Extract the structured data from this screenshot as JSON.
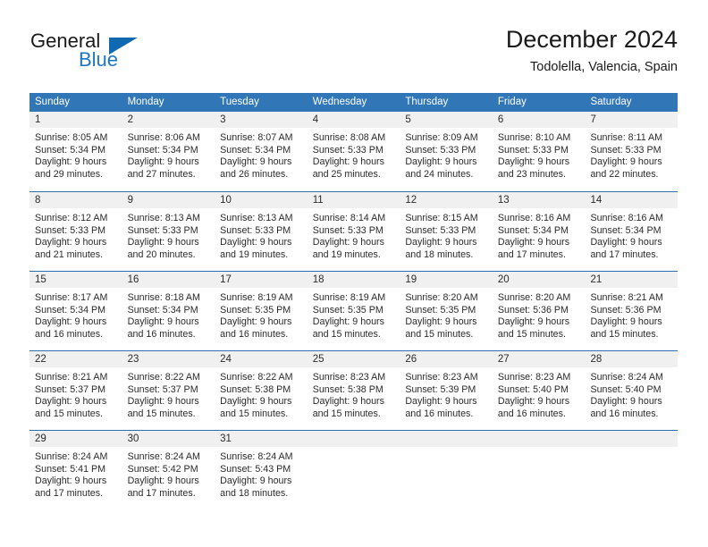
{
  "brand": {
    "name_part1": "General",
    "name_part2": "Blue",
    "accent_color": "#1f77c4"
  },
  "header": {
    "title": "December 2024",
    "location": "Todolella, Valencia, Spain"
  },
  "calendar": {
    "header_bg": "#3176b6",
    "weekdays": [
      "Sunday",
      "Monday",
      "Tuesday",
      "Wednesday",
      "Thursday",
      "Friday",
      "Saturday"
    ],
    "weeks": [
      [
        {
          "day": "1",
          "lines": [
            "Sunrise: 8:05 AM",
            "Sunset: 5:34 PM",
            "Daylight: 9 hours",
            "and 29 minutes."
          ]
        },
        {
          "day": "2",
          "lines": [
            "Sunrise: 8:06 AM",
            "Sunset: 5:34 PM",
            "Daylight: 9 hours",
            "and 27 minutes."
          ]
        },
        {
          "day": "3",
          "lines": [
            "Sunrise: 8:07 AM",
            "Sunset: 5:34 PM",
            "Daylight: 9 hours",
            "and 26 minutes."
          ]
        },
        {
          "day": "4",
          "lines": [
            "Sunrise: 8:08 AM",
            "Sunset: 5:33 PM",
            "Daylight: 9 hours",
            "and 25 minutes."
          ]
        },
        {
          "day": "5",
          "lines": [
            "Sunrise: 8:09 AM",
            "Sunset: 5:33 PM",
            "Daylight: 9 hours",
            "and 24 minutes."
          ]
        },
        {
          "day": "6",
          "lines": [
            "Sunrise: 8:10 AM",
            "Sunset: 5:33 PM",
            "Daylight: 9 hours",
            "and 23 minutes."
          ]
        },
        {
          "day": "7",
          "lines": [
            "Sunrise: 8:11 AM",
            "Sunset: 5:33 PM",
            "Daylight: 9 hours",
            "and 22 minutes."
          ]
        }
      ],
      [
        {
          "day": "8",
          "lines": [
            "Sunrise: 8:12 AM",
            "Sunset: 5:33 PM",
            "Daylight: 9 hours",
            "and 21 minutes."
          ]
        },
        {
          "day": "9",
          "lines": [
            "Sunrise: 8:13 AM",
            "Sunset: 5:33 PM",
            "Daylight: 9 hours",
            "and 20 minutes."
          ]
        },
        {
          "day": "10",
          "lines": [
            "Sunrise: 8:13 AM",
            "Sunset: 5:33 PM",
            "Daylight: 9 hours",
            "and 19 minutes."
          ]
        },
        {
          "day": "11",
          "lines": [
            "Sunrise: 8:14 AM",
            "Sunset: 5:33 PM",
            "Daylight: 9 hours",
            "and 19 minutes."
          ]
        },
        {
          "day": "12",
          "lines": [
            "Sunrise: 8:15 AM",
            "Sunset: 5:33 PM",
            "Daylight: 9 hours",
            "and 18 minutes."
          ]
        },
        {
          "day": "13",
          "lines": [
            "Sunrise: 8:16 AM",
            "Sunset: 5:34 PM",
            "Daylight: 9 hours",
            "and 17 minutes."
          ]
        },
        {
          "day": "14",
          "lines": [
            "Sunrise: 8:16 AM",
            "Sunset: 5:34 PM",
            "Daylight: 9 hours",
            "and 17 minutes."
          ]
        }
      ],
      [
        {
          "day": "15",
          "lines": [
            "Sunrise: 8:17 AM",
            "Sunset: 5:34 PM",
            "Daylight: 9 hours",
            "and 16 minutes."
          ]
        },
        {
          "day": "16",
          "lines": [
            "Sunrise: 8:18 AM",
            "Sunset: 5:34 PM",
            "Daylight: 9 hours",
            "and 16 minutes."
          ]
        },
        {
          "day": "17",
          "lines": [
            "Sunrise: 8:19 AM",
            "Sunset: 5:35 PM",
            "Daylight: 9 hours",
            "and 16 minutes."
          ]
        },
        {
          "day": "18",
          "lines": [
            "Sunrise: 8:19 AM",
            "Sunset: 5:35 PM",
            "Daylight: 9 hours",
            "and 15 minutes."
          ]
        },
        {
          "day": "19",
          "lines": [
            "Sunrise: 8:20 AM",
            "Sunset: 5:35 PM",
            "Daylight: 9 hours",
            "and 15 minutes."
          ]
        },
        {
          "day": "20",
          "lines": [
            "Sunrise: 8:20 AM",
            "Sunset: 5:36 PM",
            "Daylight: 9 hours",
            "and 15 minutes."
          ]
        },
        {
          "day": "21",
          "lines": [
            "Sunrise: 8:21 AM",
            "Sunset: 5:36 PM",
            "Daylight: 9 hours",
            "and 15 minutes."
          ]
        }
      ],
      [
        {
          "day": "22",
          "lines": [
            "Sunrise: 8:21 AM",
            "Sunset: 5:37 PM",
            "Daylight: 9 hours",
            "and 15 minutes."
          ]
        },
        {
          "day": "23",
          "lines": [
            "Sunrise: 8:22 AM",
            "Sunset: 5:37 PM",
            "Daylight: 9 hours",
            "and 15 minutes."
          ]
        },
        {
          "day": "24",
          "lines": [
            "Sunrise: 8:22 AM",
            "Sunset: 5:38 PM",
            "Daylight: 9 hours",
            "and 15 minutes."
          ]
        },
        {
          "day": "25",
          "lines": [
            "Sunrise: 8:23 AM",
            "Sunset: 5:38 PM",
            "Daylight: 9 hours",
            "and 15 minutes."
          ]
        },
        {
          "day": "26",
          "lines": [
            "Sunrise: 8:23 AM",
            "Sunset: 5:39 PM",
            "Daylight: 9 hours",
            "and 16 minutes."
          ]
        },
        {
          "day": "27",
          "lines": [
            "Sunrise: 8:23 AM",
            "Sunset: 5:40 PM",
            "Daylight: 9 hours",
            "and 16 minutes."
          ]
        },
        {
          "day": "28",
          "lines": [
            "Sunrise: 8:24 AM",
            "Sunset: 5:40 PM",
            "Daylight: 9 hours",
            "and 16 minutes."
          ]
        }
      ],
      [
        {
          "day": "29",
          "lines": [
            "Sunrise: 8:24 AM",
            "Sunset: 5:41 PM",
            "Daylight: 9 hours",
            "and 17 minutes."
          ]
        },
        {
          "day": "30",
          "lines": [
            "Sunrise: 8:24 AM",
            "Sunset: 5:42 PM",
            "Daylight: 9 hours",
            "and 17 minutes."
          ]
        },
        {
          "day": "31",
          "lines": [
            "Sunrise: 8:24 AM",
            "Sunset: 5:43 PM",
            "Daylight: 9 hours",
            "and 18 minutes."
          ]
        },
        {
          "day": "",
          "lines": []
        },
        {
          "day": "",
          "lines": []
        },
        {
          "day": "",
          "lines": []
        },
        {
          "day": "",
          "lines": []
        }
      ]
    ]
  }
}
